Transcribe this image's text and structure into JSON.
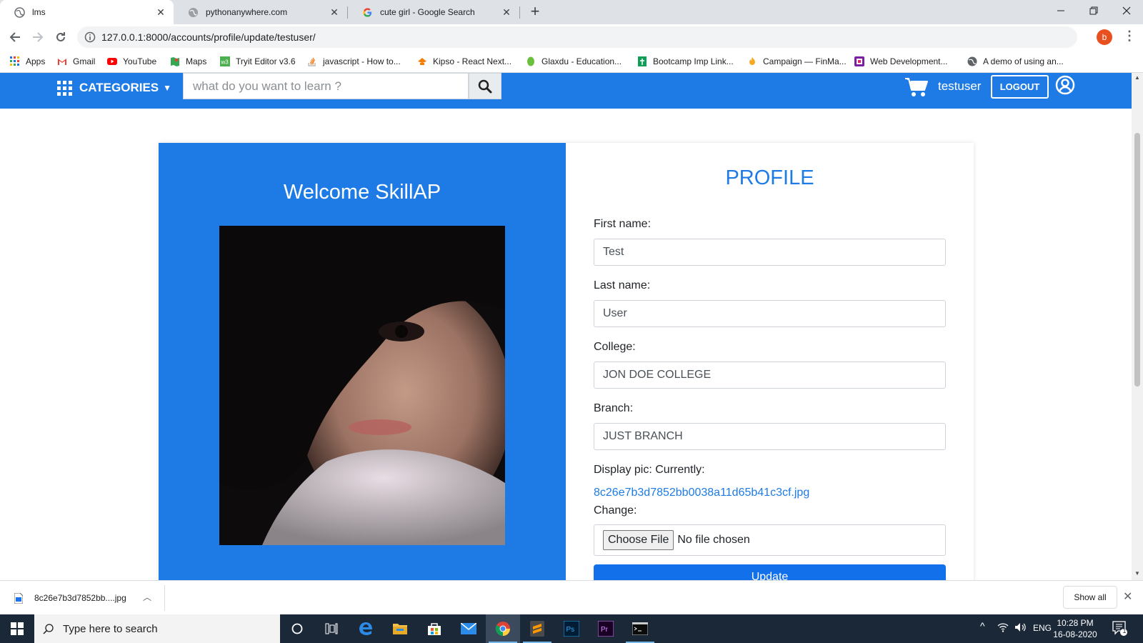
{
  "browser": {
    "tabs": [
      {
        "title": "lms",
        "icon": "globe-icon",
        "active": true
      },
      {
        "title": "pythonanywhere.com",
        "icon": "globe-icon",
        "active": false
      },
      {
        "title": "cute girl - Google Search",
        "icon": "google-icon",
        "active": false
      }
    ],
    "url": "127.0.0.1:8000/accounts/profile/update/testuser/",
    "profile_initial": "b",
    "bookmarks": [
      {
        "label": "Apps",
        "icon": "apps-grid-icon"
      },
      {
        "label": "Gmail",
        "icon": "gmail-icon"
      },
      {
        "label": "YouTube",
        "icon": "youtube-icon"
      },
      {
        "label": "Maps",
        "icon": "maps-icon"
      },
      {
        "label": "Tryit Editor v3.6",
        "icon": "w3schools-icon"
      },
      {
        "label": "javascript - How to...",
        "icon": "stackoverflow-icon"
      },
      {
        "label": "Kipso - React Next...",
        "icon": "kipso-icon"
      },
      {
        "label": "Glaxdu - Education...",
        "icon": "leaf-icon"
      },
      {
        "label": "Bootcamp Imp Link...",
        "icon": "green-doc-icon"
      },
      {
        "label": "Campaign — FinMa...",
        "icon": "flame-icon"
      },
      {
        "label": "Web Development...",
        "icon": "purple-square-icon"
      },
      {
        "label": "A demo of using an...",
        "icon": "globe-icon"
      }
    ]
  },
  "site": {
    "nav": {
      "categories_label": "CATEGORIES",
      "search_placeholder": "what do you want to learn ?",
      "username": "testuser",
      "logout_label": "LOGOUT"
    },
    "welcome": "Welcome SkillAP",
    "profile_title": "PROFILE",
    "form": {
      "first_name_label": "First name:",
      "first_name_value": "Test",
      "last_name_label": "Last name:",
      "last_name_value": "User",
      "college_label": "College:",
      "college_value": "JON DOE COLLEGE",
      "branch_label": "Branch:",
      "branch_value": "JUST BRANCH",
      "display_pic_label": "Display pic: Currently:",
      "current_pic": "8c26e7b3d7852bb0038a11d65b41c3cf.jpg",
      "change_label": "Change:",
      "choose_file_label": "Choose File",
      "no_file_label": "No file chosen",
      "update_label": "Update"
    }
  },
  "download_shelf": {
    "file_name": "8c26e7b3d7852bb....jpg",
    "show_all_label": "Show all"
  },
  "taskbar": {
    "search_placeholder": "Type here to search",
    "language": "ENG",
    "time": "10:28 PM",
    "date": "16-08-2020",
    "notification_count": "1"
  },
  "colors": {
    "brand_blue": "#1e7be6",
    "button_blue": "#1170ea",
    "taskbar": "#1b2838"
  }
}
